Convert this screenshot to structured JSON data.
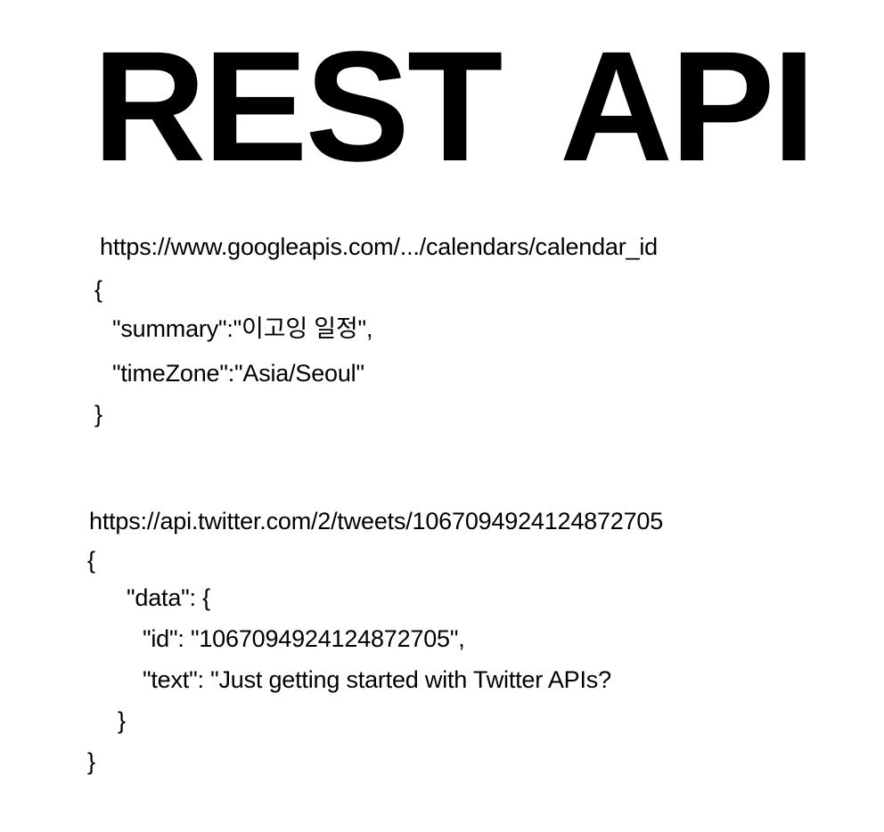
{
  "title": {
    "word1": "REST",
    "word2": "API"
  },
  "example_google": {
    "url": "https://www.googleapis.com/.../calendars/calendar_id",
    "open_brace": "{",
    "summary_line": "\"summary\":\"이고잉 일정\",",
    "timezone_line": "\"timeZone\":\"Asia/Seoul\"",
    "close_brace": "}"
  },
  "example_twitter": {
    "url": "https://api.twitter.com/2/tweets/1067094924124872705",
    "open_brace": "{",
    "data_line": "\"data\": {",
    "id_line": "\"id\": \"1067094924124872705\",",
    "text_line": "\"text\": \"Just getting started with Twitter APIs?",
    "inner_close_brace": "}",
    "close_brace": "}"
  }
}
